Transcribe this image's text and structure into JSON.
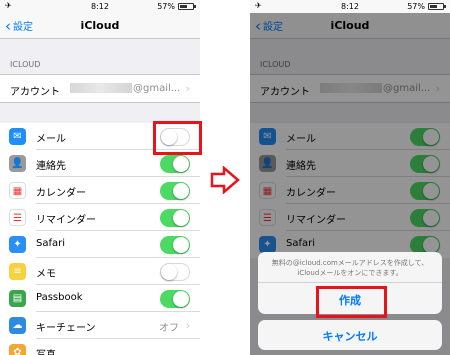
{
  "status": {
    "signal": "✈",
    "time": "8:12",
    "battery": "57%",
    "battery_level": 0.57
  },
  "nav": {
    "back_label": "設定",
    "title": "iCloud"
  },
  "section_header": "ICLOUD",
  "account": {
    "label": "アカウント",
    "value_suffix": "@gmail..."
  },
  "left_rows": [
    {
      "label": "メール",
      "icon": "mail-icon",
      "color": "#1f8ef8",
      "state": "off"
    },
    {
      "label": "連絡先",
      "icon": "contacts-icon",
      "color": "#9a9a9a",
      "state": "on"
    },
    {
      "label": "カレンダー",
      "icon": "calendar-icon",
      "color": "#ffffff",
      "state": "on"
    },
    {
      "label": "リマインダー",
      "icon": "reminders-icon",
      "color": "#ffffff",
      "state": "on"
    },
    {
      "label": "Safari",
      "icon": "safari-icon",
      "color": "#2a8ff7",
      "state": "on"
    },
    {
      "label": "メモ",
      "icon": "notes-icon",
      "color": "#f7d23e",
      "state": "off"
    },
    {
      "label": "Passbook",
      "icon": "passbook-icon",
      "color": "#3aa64b",
      "state": "on"
    },
    {
      "label": "キーチェーン",
      "icon": "keychain-icon",
      "color": "#2f8be0",
      "state": "value",
      "value": "オフ"
    },
    {
      "label": "写真",
      "icon": "photos-icon",
      "color": "#f4a532",
      "state": "partial"
    }
  ],
  "right_rows": [
    {
      "label": "メール",
      "icon": "mail-icon",
      "color": "#1f8ef8",
      "state": "on"
    },
    {
      "label": "連絡先",
      "icon": "contacts-icon",
      "color": "#9a9a9a",
      "state": "on"
    },
    {
      "label": "カレンダー",
      "icon": "calendar-icon",
      "color": "#ffffff",
      "state": "on"
    },
    {
      "label": "リマインダー",
      "icon": "reminders-icon",
      "color": "#ffffff",
      "state": "on"
    },
    {
      "label": "Safari",
      "icon": "safari-icon",
      "color": "#2a8ff7",
      "state": "on"
    }
  ],
  "alert": {
    "message_line1": "無料の@icloud.comメールアドレスを作成して、",
    "message_line2": "iCloudメールをオンにできます。",
    "create_label": "作成",
    "cancel_label": "キャンセル"
  },
  "colors": {
    "accent": "#007aff",
    "toggle_on": "#4cd964",
    "highlight": "#e8141b"
  }
}
